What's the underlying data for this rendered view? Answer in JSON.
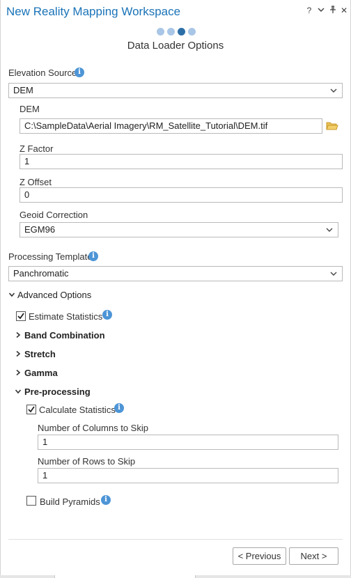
{
  "window": {
    "title": "New Reality Mapping Workspace",
    "help": "?",
    "menu": "˅",
    "pin": "†",
    "close": "✕"
  },
  "wizard": {
    "steps_total": 4,
    "current_step": 3,
    "page_title": "Data Loader Options"
  },
  "elevation": {
    "label": "Elevation Source",
    "value": "DEM",
    "dem_label": "DEM",
    "dem_path": "C:\\SampleData\\Aerial Imagery\\RM_Satellite_Tutorial\\DEM.tif",
    "zfactor_label": "Z Factor",
    "zfactor_value": "1",
    "zoffset_label": "Z Offset",
    "zoffset_value": "0",
    "geoid_label": "Geoid Correction",
    "geoid_value": "EGM96"
  },
  "template": {
    "label": "Processing Template",
    "value": "Panchromatic"
  },
  "advanced": {
    "label": "Advanced Options",
    "estimate_statistics": {
      "label": "Estimate Statistics",
      "checked": true
    },
    "band_combination": "Band Combination",
    "stretch": "Stretch",
    "gamma": "Gamma",
    "preprocessing": {
      "label": "Pre-processing",
      "calculate_statistics": {
        "label": "Calculate Statistics",
        "checked": true
      },
      "columns_label": "Number of Columns to Skip",
      "columns_value": "1",
      "rows_label": "Number of Rows to Skip",
      "rows_value": "1",
      "build_pyramids": {
        "label": "Build Pyramids",
        "checked": false
      }
    }
  },
  "footer": {
    "previous": "< Previous",
    "next": "Next >"
  },
  "colors": {
    "title": "#1a73b8",
    "info": "#4d95d6",
    "step_active": "#2d6fa7",
    "step_inactive": "#a9c6e6",
    "folder": "#e2b53e"
  }
}
